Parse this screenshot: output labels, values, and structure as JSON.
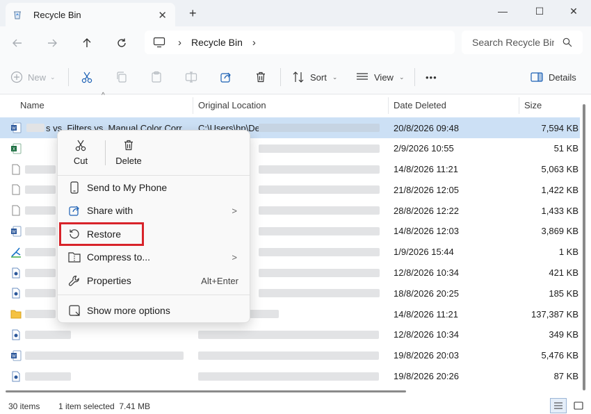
{
  "window": {
    "tab_title": "Recycle Bin",
    "tab_close": "✕",
    "new_tab": "+",
    "minimize": "—",
    "maximize": "☐",
    "close": "✕"
  },
  "address": {
    "location": "Recycle Bin",
    "search_placeholder": "Search Recycle Bin"
  },
  "toolbar": {
    "new_label": "New",
    "sort_label": "Sort",
    "view_label": "View",
    "more_label": "•••",
    "details_label": "Details"
  },
  "columns": {
    "name": "Name",
    "original_location": "Original Location",
    "date_deleted": "Date Deleted",
    "size": "Size"
  },
  "rows": [
    {
      "icon": "word-icon",
      "name": "s vs. Filters vs. Manual Color Corr...",
      "location": "C:\\Users\\hp\\De",
      "date": "20/8/2026 09:48",
      "size": "7,594 KB"
    },
    {
      "icon": "excel-icon",
      "name": "",
      "location": "",
      "date": "2/9/2026 10:55",
      "size": "51 KB"
    },
    {
      "icon": "file-icon",
      "name": "",
      "location": "",
      "date": "14/8/2026 11:21",
      "size": "5,063 KB"
    },
    {
      "icon": "file-icon",
      "name": "",
      "location": "",
      "date": "21/8/2026 12:05",
      "size": "1,422 KB"
    },
    {
      "icon": "file-icon",
      "name": "",
      "location": "",
      "date": "28/8/2026 12:22",
      "size": "1,433 KB"
    },
    {
      "icon": "word-icon",
      "name": "",
      "location": "",
      "date": "14/8/2026 12:03",
      "size": "3,869 KB"
    },
    {
      "icon": "setup-icon",
      "name": "",
      "location": "",
      "date": "1/9/2026 15:44",
      "size": "1 KB"
    },
    {
      "icon": "doc-icon",
      "name": "",
      "location": "",
      "date": "12/8/2026 10:34",
      "size": "421 KB"
    },
    {
      "icon": "doc-icon",
      "name": "",
      "location": "",
      "date": "18/8/2026 20:25",
      "size": "185 KB"
    },
    {
      "icon": "folder-icon",
      "name": "",
      "location": "",
      "date": "14/8/2026 11:21",
      "size": "137,387 KB"
    },
    {
      "icon": "doc-icon",
      "name": "",
      "location": "",
      "date": "12/8/2026 10:34",
      "size": "349 KB"
    },
    {
      "icon": "word-icon",
      "name": "",
      "location": "",
      "date": "19/8/2026 20:03",
      "size": "5,476 KB"
    },
    {
      "icon": "doc-icon",
      "name": "",
      "location": "",
      "date": "19/8/2026 20:26",
      "size": "87 KB"
    }
  ],
  "context_menu": {
    "cut": "Cut",
    "delete": "Delete",
    "send_to_phone": "Send to My Phone",
    "share_with": "Share with",
    "restore": "Restore",
    "compress_to": "Compress to...",
    "properties": "Properties",
    "properties_shortcut": "Alt+Enter",
    "show_more": "Show more options",
    "submenu_arrow": ">"
  },
  "status": {
    "items": "30 items",
    "selected": "1 item selected  7.41 MB"
  },
  "colors": {
    "selection": "#cce0f5",
    "highlight_box": "#d8232a",
    "accent": "#1a5fb4"
  }
}
